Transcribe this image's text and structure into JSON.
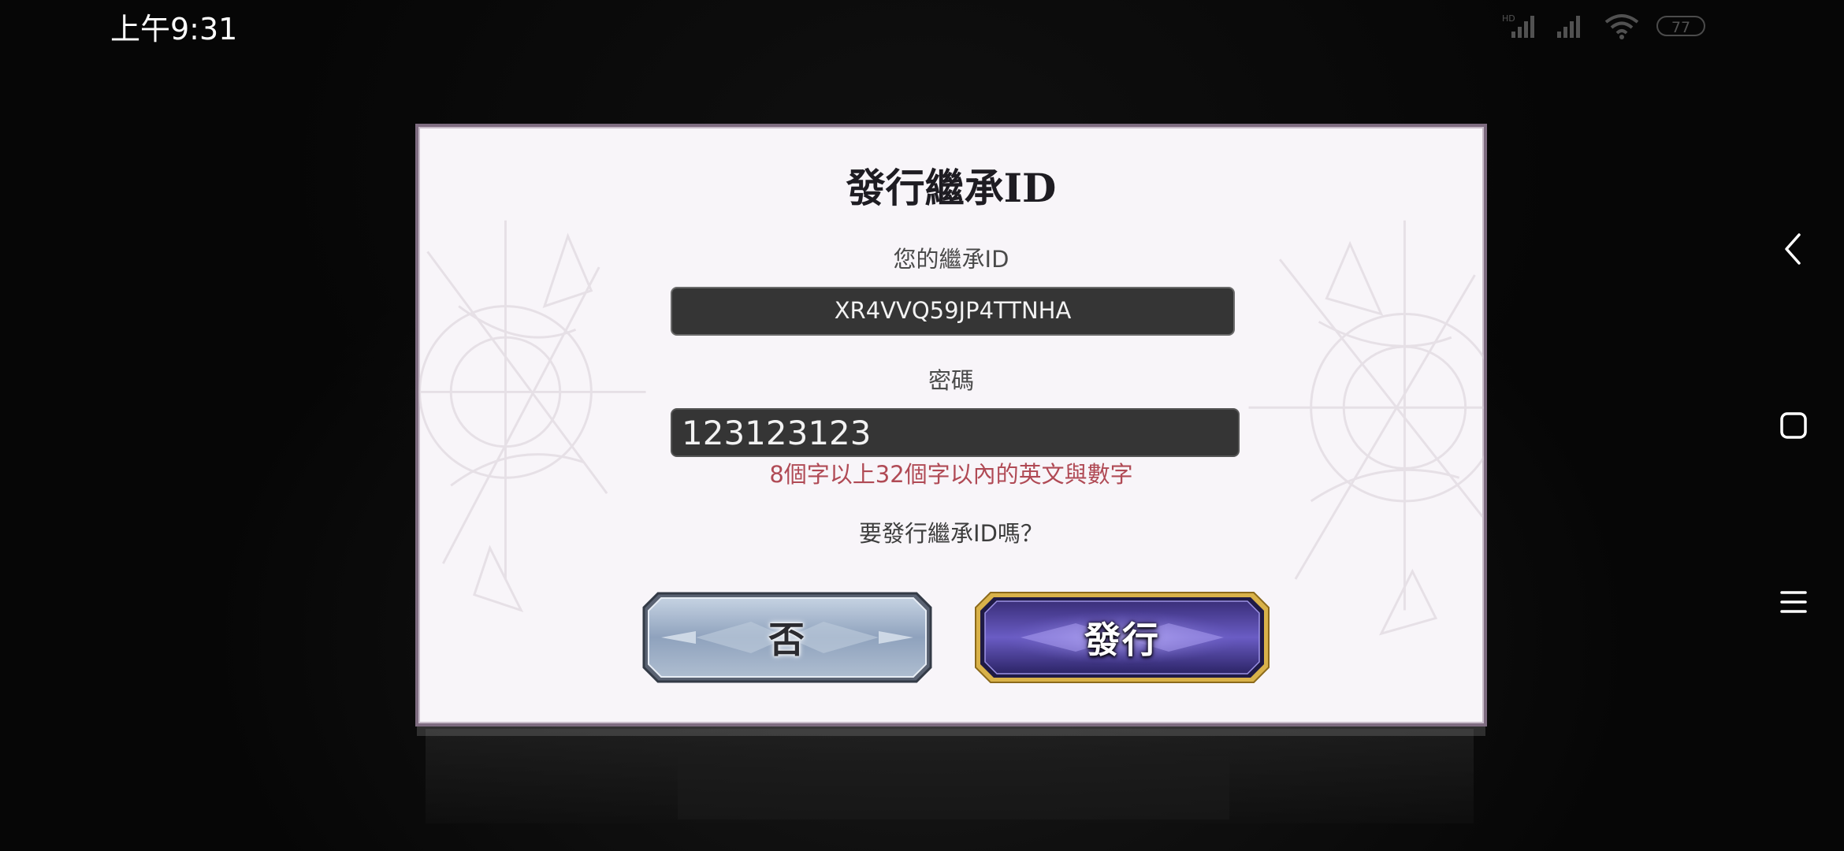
{
  "status_bar": {
    "time": "上午9:31",
    "battery": "77",
    "icons": [
      "hd-signal-icon",
      "signal-icon",
      "wifi-icon",
      "battery-icon"
    ]
  },
  "nav": {
    "icons": [
      "back-icon",
      "home-icon",
      "menu-icon"
    ]
  },
  "dialog": {
    "title": "發行繼承ID",
    "id_label": "您的繼承ID",
    "id_value": "XR4VVQ59JP4TTNHA",
    "password_label": "密碼",
    "password_value": "123123123",
    "password_hint": "8個字以上32個字以內的英文與數字",
    "question": "要發行繼承ID嗎？",
    "no_label": "否",
    "yes_label": "發行"
  },
  "colors": {
    "dialog_bg": "#f8f5f9",
    "dialog_border": "#7e6c80",
    "field_bg": "#353535",
    "hint_red": "#b04a55",
    "no_button": "#9fb0c8",
    "yes_button": "#4a3f9a",
    "yes_button_border": "#d9b24a"
  }
}
